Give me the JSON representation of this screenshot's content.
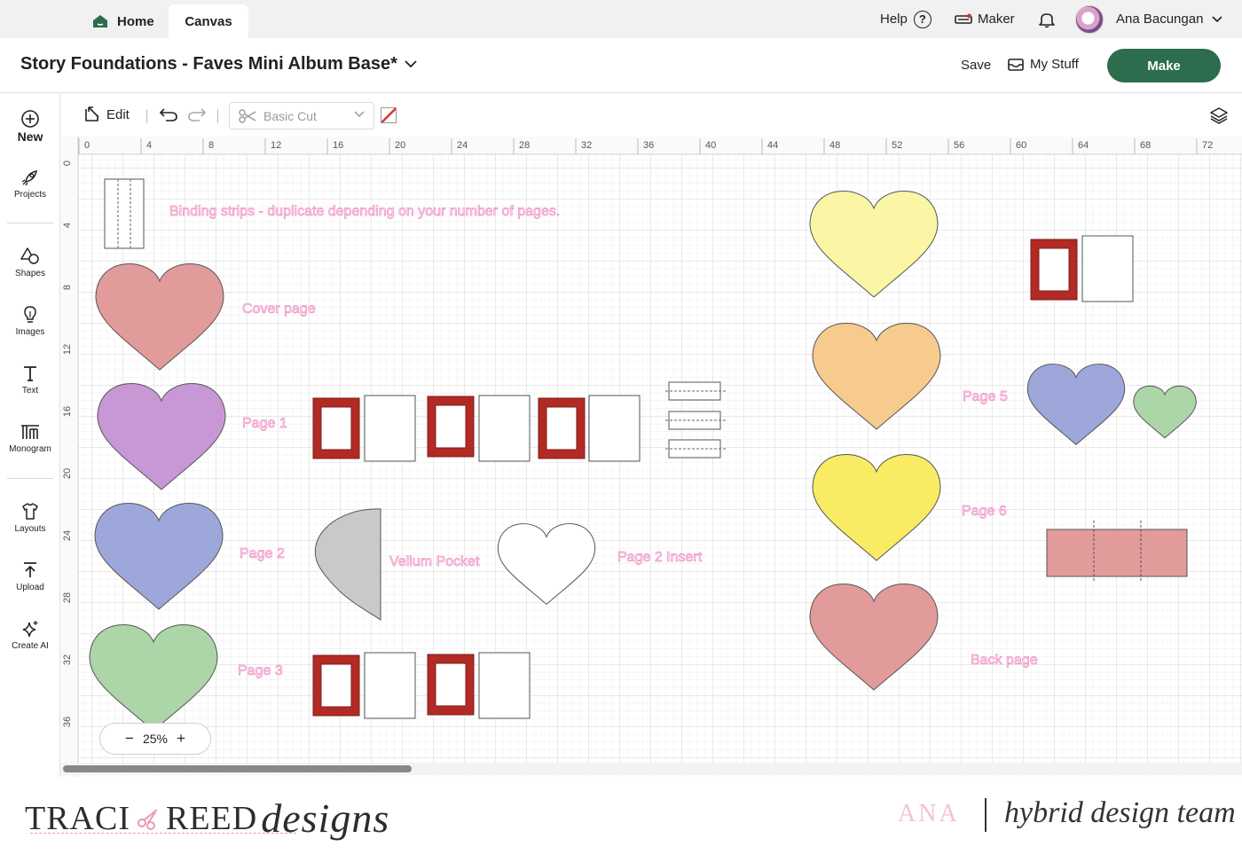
{
  "tabs": {
    "home": "Home",
    "canvas": "Canvas"
  },
  "topbar": {
    "help": "Help",
    "help_icon": "?",
    "maker": "Maker",
    "user_name": "Ana Bacungan"
  },
  "project": {
    "title": "Story Foundations - Faves Mini Album Base*",
    "save": "Save",
    "my_stuff": "My Stuff",
    "make": "Make"
  },
  "sidebar": {
    "items": [
      {
        "label": "New",
        "icon": "plus-circle-icon"
      },
      {
        "label": "Projects",
        "icon": "rocket-icon"
      },
      {
        "label": "Shapes",
        "icon": "shapes-icon"
      },
      {
        "label": "Images",
        "icon": "lightbulb-icon"
      },
      {
        "label": "Text",
        "icon": "text-icon"
      },
      {
        "label": "Monogram",
        "icon": "monogram-icon"
      },
      {
        "label": "Layouts",
        "icon": "layouts-icon"
      },
      {
        "label": "Upload",
        "icon": "upload-icon"
      },
      {
        "label": "Create AI",
        "icon": "sparkle-icon"
      }
    ]
  },
  "toolbar": {
    "edit": "Edit",
    "operation": "Basic Cut"
  },
  "ruler": {
    "top": [
      "0",
      "4",
      "8",
      "12",
      "16",
      "20",
      "24",
      "28",
      "32",
      "36",
      "40",
      "44",
      "48",
      "52",
      "56",
      "60",
      "64",
      "68",
      "72"
    ],
    "left": [
      "0",
      "4",
      "8",
      "12",
      "16",
      "20",
      "24",
      "28",
      "32",
      "36"
    ]
  },
  "canvas_labels": {
    "binding": "Binding strips - duplicate depending on your number of pages.",
    "cover": "Cover page",
    "page1": "Page 1",
    "page2": "Page 2",
    "page3": "Page 3",
    "vellum": "Vellum Pocket",
    "page2_insert": "Page 2 Insert",
    "page5": "Page 5",
    "page6": "Page 6",
    "back": "Back page"
  },
  "zoom": {
    "value": "25%",
    "minus": "−",
    "plus": "+"
  },
  "footer": {
    "brand_left": "TRACI",
    "brand_mid": "REED",
    "brand_script": "designs",
    "member": "ANA",
    "team": "hybrid design team"
  },
  "colors": {
    "accent_green": "#2b6d4c",
    "heart_red": "#e29b9b",
    "heart_purple": "#c897d6",
    "heart_blue": "#9da7d9",
    "heart_green": "#acd5a8",
    "heart_lightyellow": "#fbf6a6",
    "heart_orange": "#f6cb8d",
    "heart_yellow": "#faeb65",
    "frame_red": "#b32a25",
    "label_pink": "#f2a6d2"
  }
}
